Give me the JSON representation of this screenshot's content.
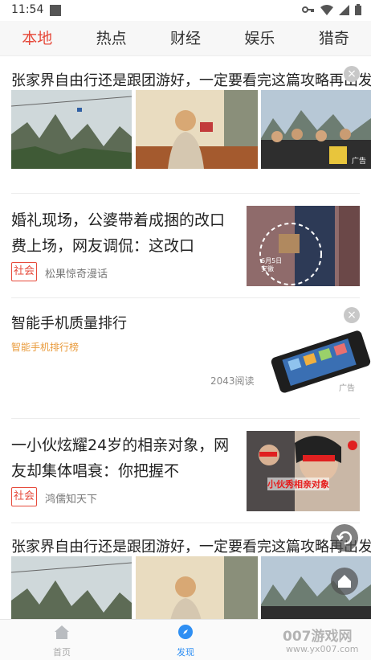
{
  "status_bar": {
    "time": "11:54"
  },
  "tabs": [
    {
      "label": "本地",
      "active": true
    },
    {
      "label": "热点",
      "active": false
    },
    {
      "label": "财经",
      "active": false
    },
    {
      "label": "娱乐",
      "active": false
    },
    {
      "label": "猎奇",
      "active": false
    }
  ],
  "feed": {
    "item1": {
      "title": "张家界自由行还是跟团游好，一定要看完这篇攻略再出发",
      "ad_label": "广告"
    },
    "item2": {
      "title": "婚礼现场，公婆带着成捆的改口费上场，网友调侃：这改口",
      "tag": "社会",
      "source": "松果惊奇漫话",
      "thumb_caption": "6月5日 安徽"
    },
    "ad": {
      "title": "智能手机质量排行",
      "subtitle": "智能手机排行榜",
      "reads": "2043阅读",
      "ad_label": "广告"
    },
    "item3": {
      "title": "一小伙炫耀24岁的相亲对象，网友却集体唱衰：你把握不",
      "tag": "社会",
      "source": "鸿儒知天下",
      "thumb_caption": "小伙秀相亲对象"
    },
    "item4": {
      "title": "张家界自由行还是跟团游好，一定要看完这篇攻略再出发"
    }
  },
  "bottom_nav": [
    {
      "label": "首页",
      "icon": "home-icon",
      "active": false
    },
    {
      "label": "发现",
      "icon": "compass-icon",
      "active": true
    }
  ],
  "watermark": {
    "text": "007游戏网",
    "url": "www.yx007.com"
  },
  "colors": {
    "accent": "#e64a3b",
    "nav_active": "#2f8ff3",
    "ad_source": "#e99a3a"
  }
}
